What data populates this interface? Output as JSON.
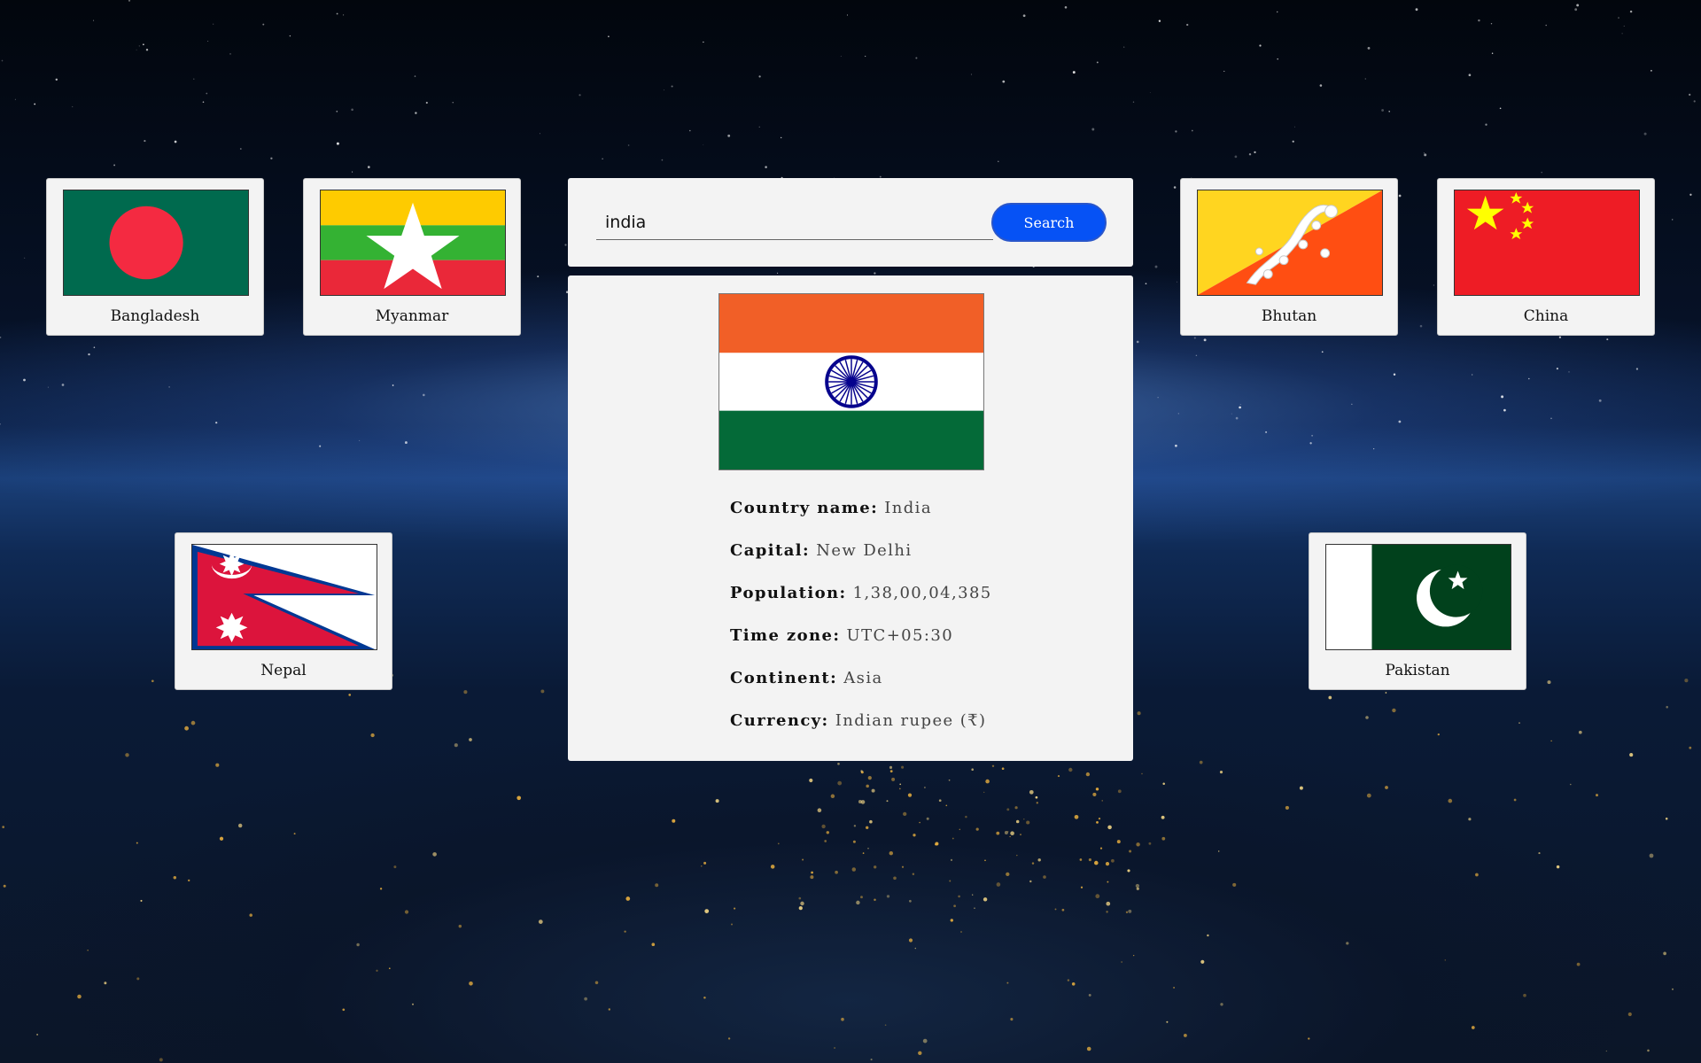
{
  "search": {
    "query": "india",
    "button_label": "Search"
  },
  "country": {
    "flag": "india-flag",
    "fields": [
      {
        "label": "Country name:",
        "value": "India"
      },
      {
        "label": "Capital:",
        "value": "New Delhi"
      },
      {
        "label": "Population:",
        "value": "1,38,00,04,385"
      },
      {
        "label": "Time zone:",
        "value": "UTC+05:30"
      },
      {
        "label": "Continent:",
        "value": "Asia"
      },
      {
        "label": "Currency:",
        "value": "Indian rupee (₹)"
      }
    ]
  },
  "neighbors": [
    {
      "name": "Bangladesh",
      "flag": "bangladesh-flag"
    },
    {
      "name": "Myanmar",
      "flag": "myanmar-flag"
    },
    {
      "name": "Bhutan",
      "flag": "bhutan-flag"
    },
    {
      "name": "China",
      "flag": "china-flag"
    },
    {
      "name": "Nepal",
      "flag": "nepal-flag"
    },
    {
      "name": "Pakistan",
      "flag": "pakistan-flag"
    }
  ],
  "colors": {
    "button": "#0652f5",
    "panel": "#f3f3f3"
  }
}
